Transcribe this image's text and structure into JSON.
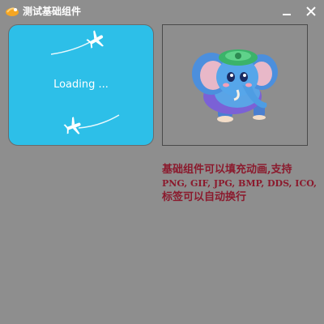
{
  "window": {
    "title": "测试基础组件",
    "icons": {
      "app": "app-logo-icon",
      "minimize": "minimize-icon",
      "close": "close-icon"
    }
  },
  "loading_panel": {
    "text": "Loading ...",
    "icons": [
      "airplane-icon",
      "airplane-icon"
    ],
    "colors": {
      "background": "#2dbfe8",
      "text": "#ffffff"
    }
  },
  "image_frame": {
    "icon": "elephant-mascot-icon"
  },
  "description": {
    "line1": "基础组件可以填充动画,支持",
    "line2": "PNG, GIF, JPG, BMP, DDS, ICO,",
    "line3": "标签可以自动换行",
    "color": "#8b1a2d"
  },
  "colors": {
    "window_background": "#8e8e8e",
    "accent": "#f5a623"
  }
}
